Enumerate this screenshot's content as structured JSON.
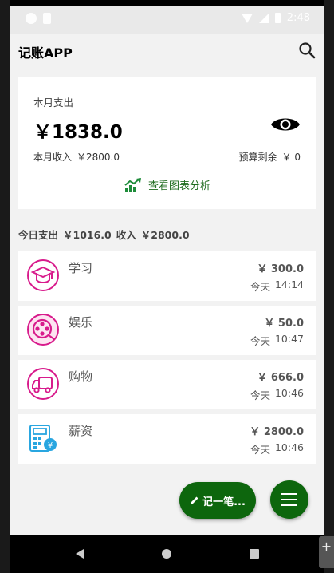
{
  "status_bar": {
    "time": "2:48"
  },
  "app": {
    "title": "记账APP"
  },
  "summary": {
    "month_expense_label": "本月支出",
    "currency": "￥",
    "month_expense": "1838.0",
    "month_income_label": "本月收入",
    "month_income": "￥2800.0",
    "budget_label": "预算剩余",
    "budget_remaining": "￥ 0",
    "analysis_link": "查看图表分析"
  },
  "today": {
    "expense_label": "今日支出",
    "expense": "￥1016.0",
    "income_label": "收入",
    "income": "￥2800.0"
  },
  "records": [
    {
      "category": "学习",
      "amount": "￥ 300.0",
      "day": "今天",
      "time": "14:14",
      "icon": "study-icon"
    },
    {
      "category": "娱乐",
      "amount": "￥ 50.0",
      "day": "今天",
      "time": "10:47",
      "icon": "entertainment-icon"
    },
    {
      "category": "购物",
      "amount": "￥ 666.0",
      "day": "今天",
      "time": "10:46",
      "icon": "shopping-icon"
    },
    {
      "category": "薪资",
      "amount": "￥ 2800.0",
      "day": "今天",
      "time": "10:46",
      "icon": "salary-icon"
    }
  ],
  "actions": {
    "record_button": "记一笔..."
  },
  "colors": {
    "accent_green": "#0d660d",
    "link_green": "#1e6b1e",
    "category_pink": "#d81b8c",
    "salary_blue": "#29a6e0"
  }
}
